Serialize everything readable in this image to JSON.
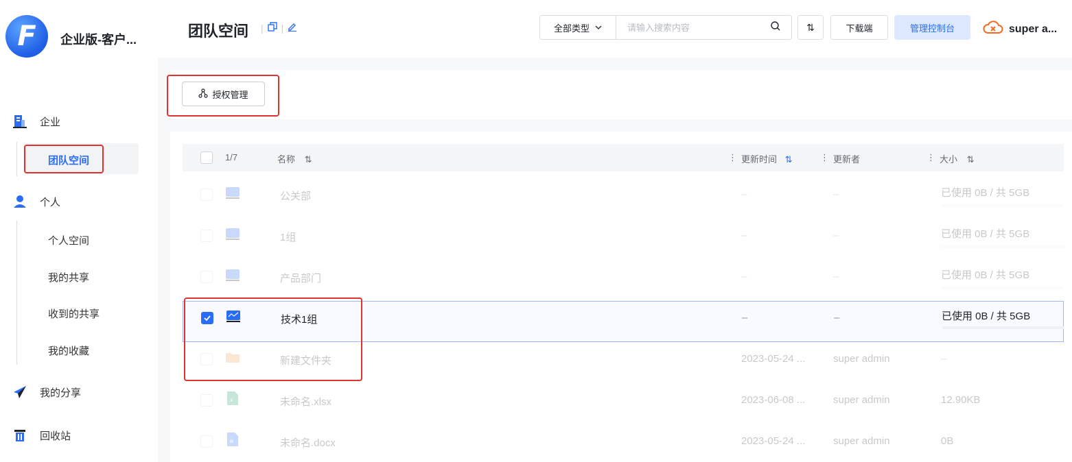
{
  "sidebar": {
    "logo_letter": "F",
    "brand": "企业版-客户...",
    "enterprise_label": "企业",
    "team_space_label": "团队空间",
    "personal_label": "个人",
    "personal_space_label": "个人空间",
    "my_shares_label": "我的共享",
    "received_shares_label": "收到的共享",
    "favorites_label": "我的收藏",
    "my_share_label": "我的分享",
    "recycle_label": "回收站"
  },
  "header": {
    "title": "团队空间",
    "type_select": "全部类型",
    "search_placeholder": "请输入搜索内容",
    "sort_symbol": "⇅",
    "download_label": "下载端",
    "admin_label": "管理控制台",
    "user_name": "super a..."
  },
  "toolbar": {
    "auth_label": "授权管理"
  },
  "table": {
    "selection_count": "1/7",
    "col_name": "名称",
    "col_updated": "更新时间",
    "col_updater": "更新者",
    "col_size": "大小",
    "rows": [
      {
        "name": "公关部",
        "updated": "–",
        "updater": "–",
        "size": "已使用 0B / 共 5GB"
      },
      {
        "name": "1组",
        "updated": "–",
        "updater": "–",
        "size": "已使用 0B / 共 5GB"
      },
      {
        "name": "产品部门",
        "updated": "–",
        "updater": "–",
        "size": "已使用 0B / 共 5GB"
      },
      {
        "name": "技术1组",
        "updated": "–",
        "updater": "–",
        "size": "已使用 0B / 共 5GB"
      },
      {
        "name": "新建文件夹",
        "updated": "2023-05-24 ...",
        "updater": "super admin",
        "size": "–"
      },
      {
        "name": "未命名.xlsx",
        "updated": "2023-06-08 ...",
        "updater": "super admin",
        "size": "12.90KB"
      },
      {
        "name": "未命名.docx",
        "updated": "2023-05-24 ...",
        "updater": "super admin",
        "size": "0B"
      }
    ]
  },
  "colors": {
    "accent": "#2b6cf6",
    "highlight_box": "#e0332f"
  }
}
